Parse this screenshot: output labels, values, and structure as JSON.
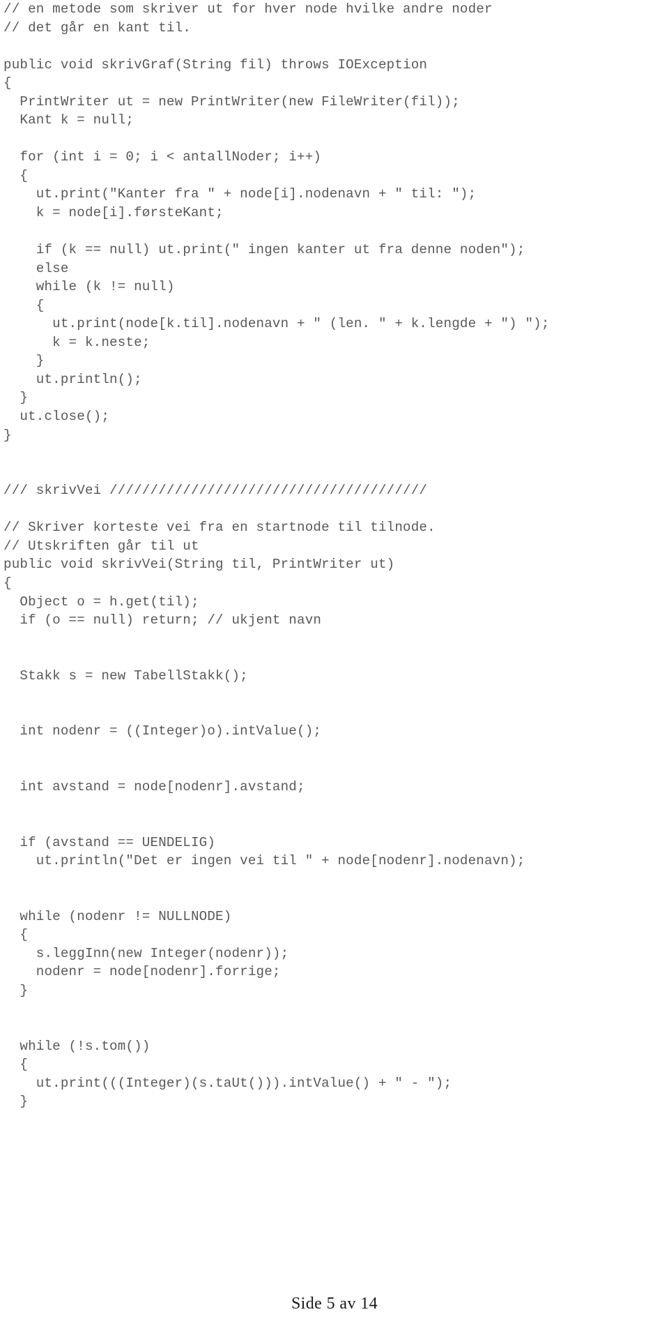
{
  "document": {
    "language": "Java",
    "text_color": "#59595b",
    "background_color": "#ffffff",
    "footer_color": "#1a1a1a"
  },
  "code": {
    "lines": [
      "// en metode som skriver ut for hver node hvilke andre noder",
      "// det går en kant til.",
      "",
      "public void skrivGraf(String fil) throws IOException",
      "{",
      "  PrintWriter ut = new PrintWriter(new FileWriter(fil));",
      "  Kant k = null;",
      "",
      "  for (int i = 0; i < antallNoder; i++)",
      "  {",
      "    ut.print(\"Kanter fra \" + node[i].nodenavn + \" til: \");",
      "    k = node[i].førsteKant;",
      "",
      "    if (k == null) ut.print(\" ingen kanter ut fra denne noden\");",
      "    else",
      "    while (k != null)",
      "    {",
      "      ut.print(node[k.til].nodenavn + \" (len. \" + k.lengde + \") \");",
      "      k = k.neste;",
      "    }",
      "    ut.println();",
      "  }",
      "  ut.close();",
      "}",
      "",
      "",
      "/// skrivVei ///////////////////////////////////////",
      "",
      "// Skriver korteste vei fra en startnode til tilnode.",
      "// Utskriften går til ut",
      "public void skrivVei(String til, PrintWriter ut)",
      "{",
      "  Object o = h.get(til);",
      "  if (o == null) return; // ukjent navn",
      "",
      "",
      "  Stakk s = new TabellStakk();",
      "",
      "",
      "  int nodenr = ((Integer)o).intValue();",
      "",
      "",
      "  int avstand = node[nodenr].avstand;",
      "",
      "",
      "  if (avstand == UENDELIG)",
      "    ut.println(\"Det er ingen vei til \" + node[nodenr].nodenavn);",
      "",
      "",
      "  while (nodenr != NULLNODE)",
      "  {",
      "    s.leggInn(new Integer(nodenr));",
      "    nodenr = node[nodenr].forrige;",
      "  }",
      "",
      "",
      "  while (!s.tom())",
      "  {",
      "    ut.print(((Integer)(s.taUt())).intValue() + \" - \");",
      "  }"
    ]
  },
  "footer": {
    "page_label": "Side 5 av 14"
  }
}
